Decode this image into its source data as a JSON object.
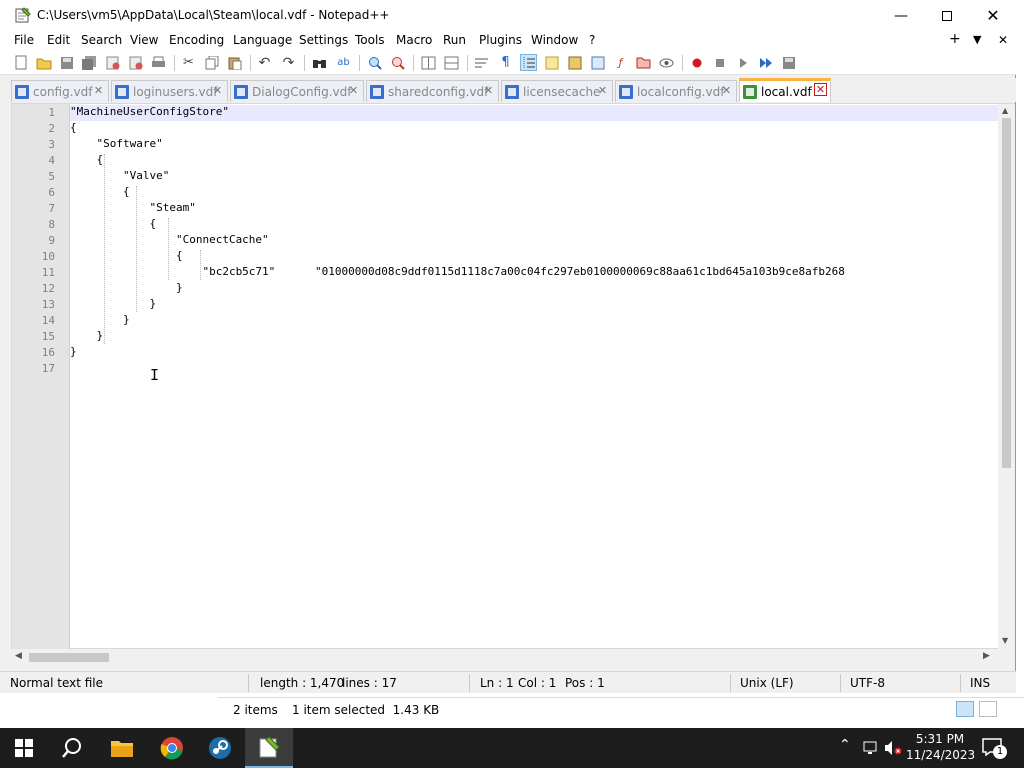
{
  "window": {
    "title": "C:\\Users\\vm5\\AppData\\Local\\Steam\\local.vdf - Notepad++"
  },
  "menu": [
    "File",
    "Edit",
    "Search",
    "View",
    "Encoding",
    "Language",
    "Settings",
    "Tools",
    "Macro",
    "Run",
    "Plugins",
    "Window",
    "?"
  ],
  "menu_right": {
    "plus": "+",
    "down": "▼",
    "close": "✕"
  },
  "tabs": [
    {
      "label": "config.vdf",
      "active": false
    },
    {
      "label": "loginusers.vdf",
      "active": false
    },
    {
      "label": "DialogConfig.vdf",
      "active": false
    },
    {
      "label": "sharedconfig.vdf",
      "active": false
    },
    {
      "label": "licensecache",
      "active": false
    },
    {
      "label": "localconfig.vdf",
      "active": false
    },
    {
      "label": "local.vdf",
      "active": true
    }
  ],
  "editor": {
    "lines": [
      "\"MachineUserConfigStore\"",
      "{",
      "    \"Software\"",
      "    {",
      "        \"Valve\"",
      "        {",
      "            \"Steam\"",
      "            {",
      "                \"ConnectCache\"",
      "                {",
      "                    \"bc2cb5c71\"      \"01000000d08c9ddf0115d1118c7a00c04fc297eb0100000069c88aa61c1bd645a103b9ce8afb268",
      "                }",
      "            }",
      "        }",
      "    }",
      "}",
      ""
    ],
    "line_numbers": [
      "1",
      "2",
      "3",
      "4",
      "5",
      "6",
      "7",
      "8",
      "9",
      "10",
      "11",
      "12",
      "13",
      "14",
      "15",
      "16",
      "17"
    ]
  },
  "status": {
    "file_type": "Normal text file",
    "length": "length : 1,470",
    "lines": "lines : 17",
    "ln": "Ln : 1",
    "col": "Col : 1",
    "pos": "Pos : 1",
    "eol": "Unix (LF)",
    "encoding": "UTF-8",
    "mode": "INS"
  },
  "explorer_status": {
    "items": "2 items",
    "selected": "1 item selected  1.43 KB"
  },
  "taskbar": {
    "time": "5:31 PM",
    "date": "11/24/2023",
    "notifications": "1"
  },
  "colors": {
    "active_tab_accent": "#fbb040",
    "current_line": "#e8e8ff",
    "taskbar": "#1d1d1d"
  }
}
